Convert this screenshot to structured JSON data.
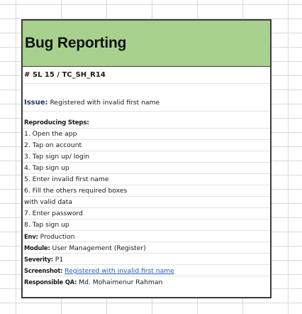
{
  "card": {
    "title": "Bug Reporting",
    "id": "# SL 15 / TC_SH_R14",
    "issue_label": "Issue:",
    "issue_text": " Registered with invalid first name",
    "steps_heading": "Reproducing Steps:",
    "steps": [
      "1. Open the app",
      "2. Tap on account",
      "3. Tap sign up/ login",
      "4. Tap sign up",
      "5. Enter invalid first name",
      "6. Fill the others required boxes",
      "with valid data",
      "7. Enter password",
      "8. Tap sign up"
    ],
    "env_label": "Env:",
    "env_value": " Production",
    "module_label": "Module:",
    "module_value": " User Management (Register)",
    "severity_label": "Severity:",
    "severity_value": " P1",
    "screenshot_label": "Screenshot:",
    "screenshot_link": "Registered with invalid first name",
    "qa_label": "Responsible QA:",
    "qa_value": " Md. Mohaimenur Rahman"
  },
  "colors": {
    "header_fill": "#a9d18e",
    "border": "#3c3c3c",
    "link": "#1f5fbf",
    "issue_label": "#1f3864"
  }
}
